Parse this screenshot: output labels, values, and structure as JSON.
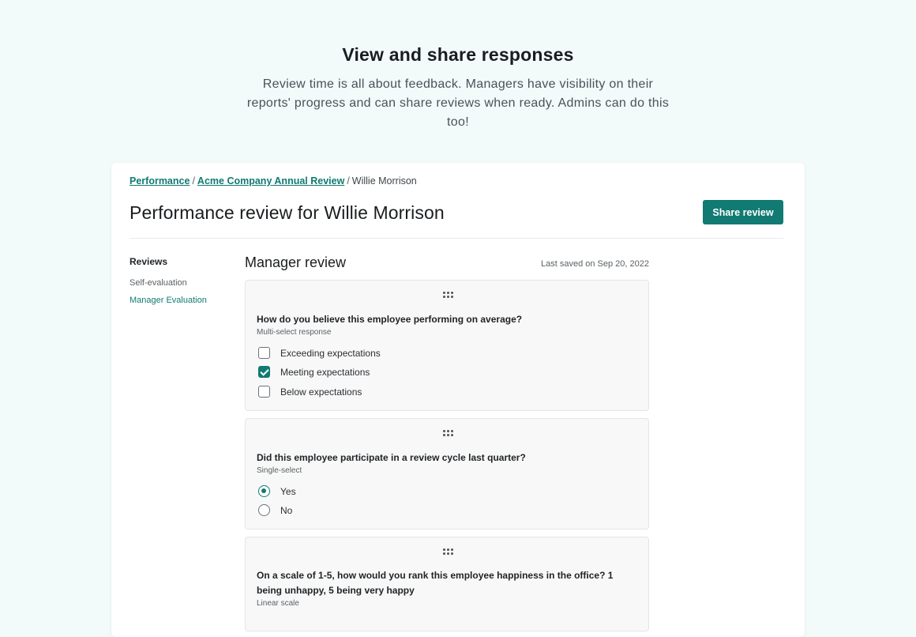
{
  "hero": {
    "title": "View and share responses",
    "subtitle": "Review time is all about feedback. Managers have visibility on their reports' progress and can share reviews when ready. Admins can do this too!"
  },
  "breadcrumb": {
    "items": [
      "Performance",
      "Acme Company Annual Review",
      "Willie Morrison"
    ],
    "separator": "/"
  },
  "page": {
    "title": "Performance review for Willie Morrison",
    "share_label": "Share review"
  },
  "sidebar": {
    "heading": "Reviews",
    "items": [
      {
        "label": "Self-evaluation",
        "active": false
      },
      {
        "label": "Manager Evaluation",
        "active": true
      }
    ]
  },
  "main": {
    "section_title": "Manager review",
    "last_saved": "Last saved on Sep 20, 2022",
    "questions": [
      {
        "text": "How do you believe this employee performing on average?",
        "type": "Multi-select response",
        "options": [
          {
            "label": "Exceeding expectations",
            "checked": false
          },
          {
            "label": "Meeting expectations",
            "checked": true
          },
          {
            "label": "Below expectations",
            "checked": false
          }
        ]
      },
      {
        "text": "Did this employee participate in a review cycle last quarter?",
        "type": "Single-select",
        "options": [
          {
            "label": "Yes",
            "checked": true
          },
          {
            "label": "No",
            "checked": false
          }
        ]
      },
      {
        "text": "On a scale of 1-5, how would you rank this employee happiness in the office? 1 being unhappy, 5 being very happy",
        "type": "Linear scale"
      }
    ]
  },
  "colors": {
    "accent": "#117a72",
    "background": "#f3fafa",
    "card": "#ffffff"
  }
}
